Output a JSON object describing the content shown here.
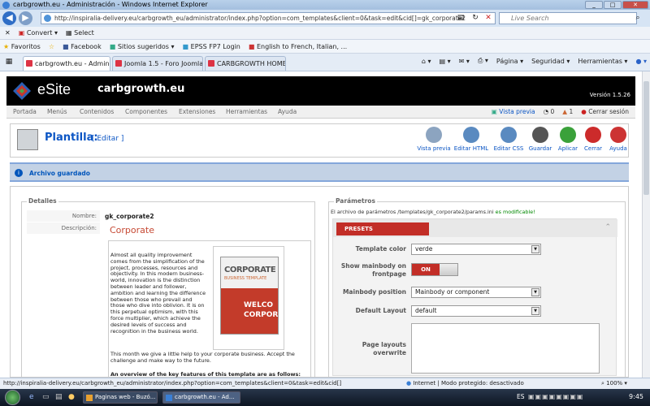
{
  "window": {
    "title": "carbgrowth.eu - Administración - Windows Internet Explorer"
  },
  "browser": {
    "url": "http://inspiralia-delivery.eu/carbgrowth_eu/administrator/index.php?option=com_templates&client=0&task=edit&cid[]=gk_corporate2",
    "search_placeholder": "Live Search",
    "toolbar": {
      "convert": "Convert",
      "select": "Select"
    },
    "favorites_label": "Favoritos",
    "favorites": [
      "Facebook",
      "Sitios sugeridos",
      "EPSS FP7 Login",
      "English to French, Italian, ..."
    ],
    "tabs": [
      "carbgrowth.eu - Admin...",
      "Joomla 1.5 - Foro Joomla ...",
      "CARBGROWTH HOME"
    ],
    "commands": {
      "page": "Página",
      "safety": "Seguridad",
      "tools": "Herramientas"
    }
  },
  "joomla": {
    "logo_text": "eSite",
    "site_name": "carbgrowth.eu",
    "version": "Versión 1.5.26",
    "menu": [
      "Portada",
      "Menús",
      "Contenidos",
      "Componentes",
      "Extensiones",
      "Herramientas",
      "Ayuda"
    ],
    "menu_right": {
      "preview": "Vista previa",
      "count1": "0",
      "count2": "1",
      "logout": "Cerrar sesión"
    },
    "title": "Plantilla:",
    "title_sub": "[ Editar ]",
    "toolbar": [
      {
        "label": "Vista previa",
        "color": "#8ca4c0"
      },
      {
        "label": "Editar HTML",
        "color": "#5a8ac0"
      },
      {
        "label": "Editar CSS",
        "color": "#5a8ac0"
      },
      {
        "label": "Guardar",
        "color": "#555555"
      },
      {
        "label": "Aplicar",
        "color": "#3aa13a"
      },
      {
        "label": "Cerrar",
        "color": "#cc2b2b"
      },
      {
        "label": "Ayuda",
        "color": "#cc3333"
      }
    ],
    "message": "Archivo guardado"
  },
  "details": {
    "legend": "Detalles",
    "name_label": "Nombre:",
    "name_value": "gk_corporate2",
    "desc_label": "Descripción:",
    "desc_title": "Corporate",
    "desc_para1": "Almost all quality improvement comes from the simplification of the project, processes, resources and objectivity. In this modern business-world, innovation is the distinction between leader and follower, ambition and learning the difference between those who prevail and those who dive into oblivion. It is on this perpetual optimism, with this force multiplier, which achieve the desired levels of success and recognition in the business world.",
    "desc_para2": "This month we give a little help to your corporate business. Accept the challenge and make way to the future.",
    "desc_overview": "An overview of the key features of this template are as follows:",
    "thumb_title": "CORPORATE",
    "thumb_sub": "BUSINESS TEMPLATE",
    "thumb_w1": "WELCO",
    "thumb_w2": "CORPOR"
  },
  "params": {
    "legend": "Parámetros",
    "info": "El archivo de parámetros /templates/gk_corporate2/params.ini",
    "info_ok": "es modificable!",
    "presets_tab": "PRESETS",
    "fields": {
      "template_color": {
        "label": "Template color",
        "value": "verde"
      },
      "show_mainbody": {
        "label": "Show mainbody on frontpage",
        "value": "ON"
      },
      "mainbody_position": {
        "label": "Mainbody position",
        "value": "Mainbody or component"
      },
      "default_layout": {
        "label": "Default Layout",
        "value": "default"
      },
      "page_layouts": {
        "label": "Page layouts overwrite"
      }
    }
  },
  "status": {
    "url": "http://inspiralia-delivery.eu/carbgrowth_eu/administrator/index.php?option=com_templates&client=0&task=edit&cid[]",
    "zone": "Internet | Modo protegido: desactivado",
    "zoom": "100%"
  },
  "taskbar": {
    "items": [
      "Paginas web - Buzó...",
      "carbgrowth.eu - Ad..."
    ],
    "lang": "ES",
    "clock": "9:45"
  }
}
